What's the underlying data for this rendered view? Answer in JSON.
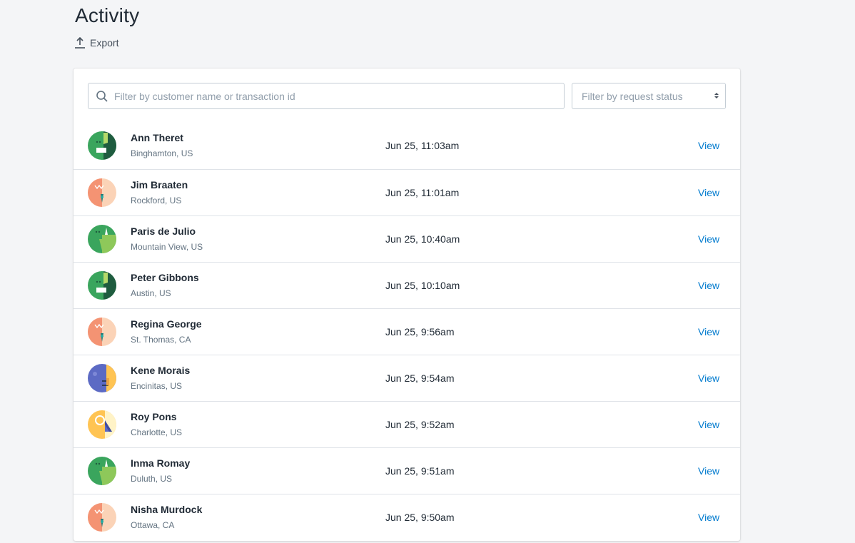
{
  "header": {
    "title": "Activity",
    "export_label": "Export"
  },
  "filters": {
    "search_placeholder": "Filter by customer name or transaction id",
    "status_placeholder": "Filter by request status"
  },
  "colors": {
    "link": "#007ace",
    "border": "#dfe3e8",
    "background": "#f4f5f7"
  },
  "activity": [
    {
      "name": "Ann Theret",
      "location": "Binghamton, US",
      "date": "Jun 25, 11:03am",
      "action": "View",
      "avatar": "green-dark"
    },
    {
      "name": "Jim Braaten",
      "location": "Rockford, US",
      "date": "Jun 25, 11:01am",
      "action": "View",
      "avatar": "orange"
    },
    {
      "name": "Paris de Julio",
      "location": "Mountain View, US",
      "date": "Jun 25, 10:40am",
      "action": "View",
      "avatar": "green-light"
    },
    {
      "name": "Peter Gibbons",
      "location": "Austin, US",
      "date": "Jun 25, 10:10am",
      "action": "View",
      "avatar": "green-dark"
    },
    {
      "name": "Regina George",
      "location": "St. Thomas, CA",
      "date": "Jun 25, 9:56am",
      "action": "View",
      "avatar": "orange"
    },
    {
      "name": "Kene Morais",
      "location": "Encinitas, US",
      "date": "Jun 25, 9:54am",
      "action": "View",
      "avatar": "purple"
    },
    {
      "name": "Roy Pons",
      "location": "Charlotte, US",
      "date": "Jun 25, 9:52am",
      "action": "View",
      "avatar": "yellow"
    },
    {
      "name": "Inma Romay",
      "location": "Duluth, US",
      "date": "Jun 25, 9:51am",
      "action": "View",
      "avatar": "green-light"
    },
    {
      "name": "Nisha Murdock",
      "location": "Ottawa, CA",
      "date": "Jun 25, 9:50am",
      "action": "View",
      "avatar": "orange"
    }
  ]
}
